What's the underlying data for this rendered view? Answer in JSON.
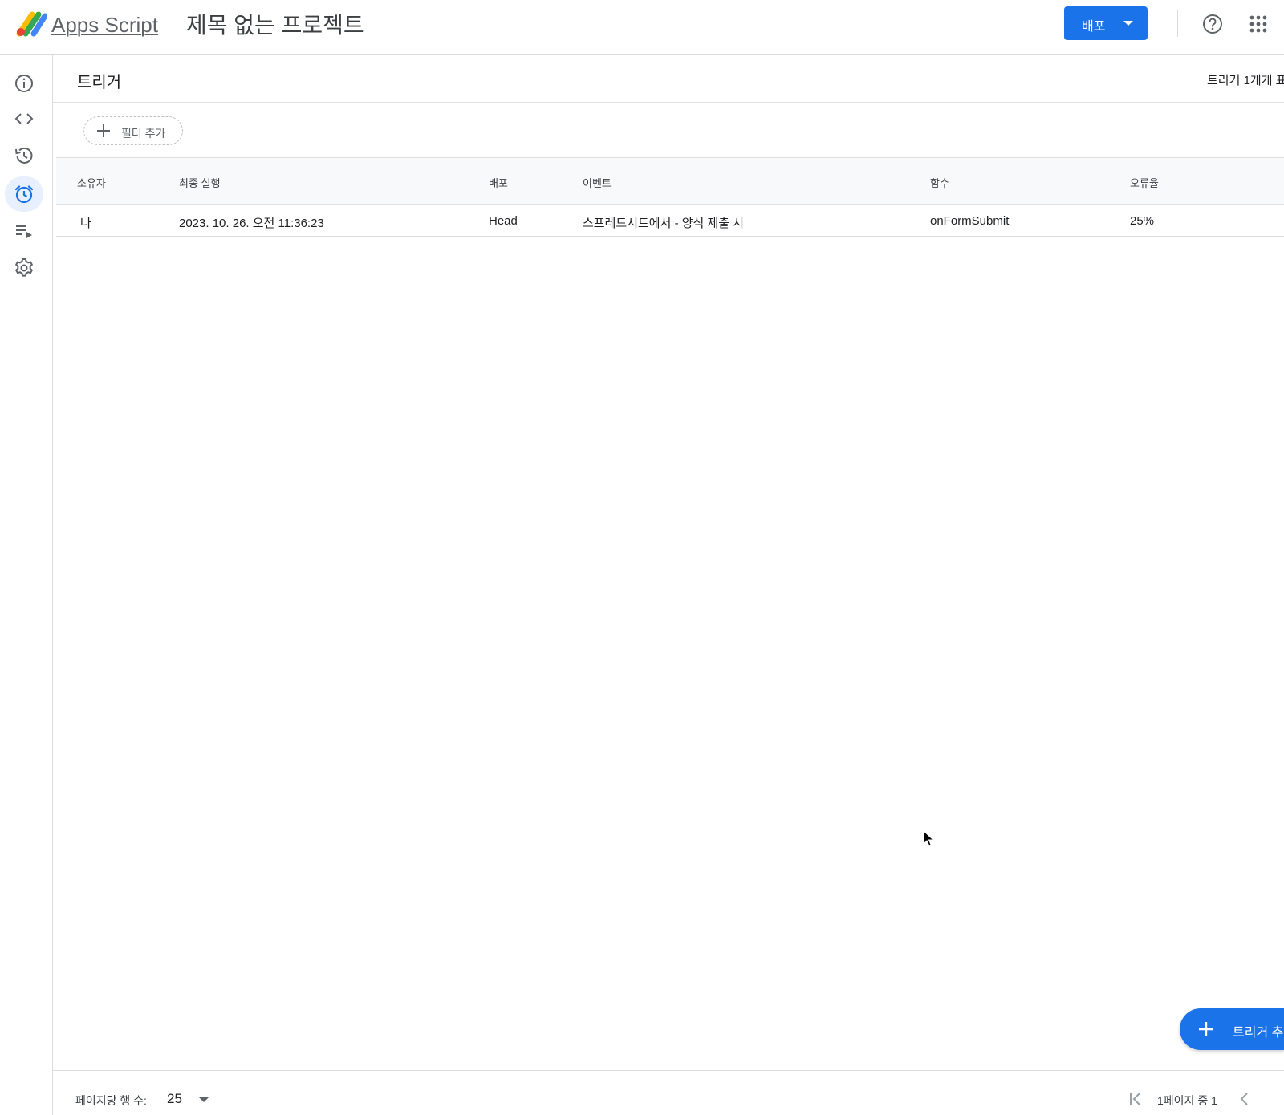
{
  "app": {
    "brand": "Apps Script",
    "project_title": "제목 없는 프로젝트",
    "deploy_label": "배포",
    "accent_color": "#1a73e8"
  },
  "rail": {
    "items": [
      {
        "icon": "info-icon",
        "active": false
      },
      {
        "icon": "code-icon",
        "active": false
      },
      {
        "icon": "history-icon",
        "active": false
      },
      {
        "icon": "alarm-icon",
        "active": true
      },
      {
        "icon": "executions-icon",
        "active": false
      },
      {
        "icon": "gear-icon",
        "active": false
      }
    ]
  },
  "triggers": {
    "title": "트리거",
    "count_text": "트리거 1개개 표",
    "filter_label": "필터 추가",
    "columns": [
      "소유자",
      "최종 실행",
      "배포",
      "이벤트",
      "함수",
      "오류율"
    ],
    "rows": [
      {
        "owner": "나",
        "last_run": "2023. 10. 26. 오전 11:36:23",
        "deployment": "Head",
        "event": "스프레드시트에서 - 양식 제출 시",
        "function": "onFormSubmit",
        "error_rate": "25%"
      }
    ],
    "add_trigger_label": "트리거 추"
  },
  "footer": {
    "rows_per_page_label": "페이지당 행 수:",
    "rows_per_page_value": "25",
    "page_info": "1페이지 중 1"
  }
}
